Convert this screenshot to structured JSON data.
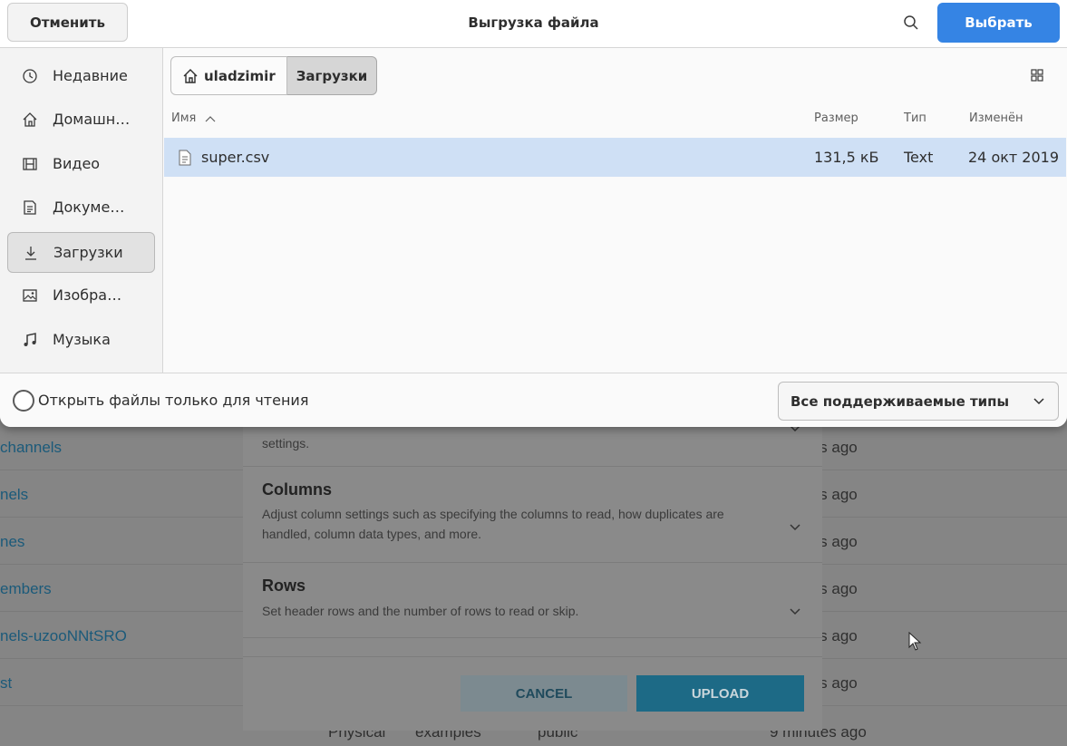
{
  "dialog": {
    "title": "Выгрузка файла",
    "cancel_label": "Отменить",
    "choose_label": "Выбрать"
  },
  "sidebar": {
    "items": [
      {
        "label": "Недавние",
        "icon": "clock-icon",
        "active": false
      },
      {
        "label": "Домашн…",
        "icon": "home-icon",
        "active": false
      },
      {
        "label": "Видео",
        "icon": "film-icon",
        "active": false
      },
      {
        "label": "Докуме…",
        "icon": "document-icon",
        "active": false
      },
      {
        "label": "Загрузки",
        "icon": "download-icon",
        "active": true
      },
      {
        "label": "Изобра…",
        "icon": "image-icon",
        "active": false
      },
      {
        "label": "Музыка",
        "icon": "music-icon",
        "active": false
      }
    ]
  },
  "pathbar": {
    "home": "uladzimir",
    "current": "Загрузки"
  },
  "columns": {
    "name": "Имя",
    "size": "Размер",
    "type": "Тип",
    "modified": "Изменён"
  },
  "files": [
    {
      "name": "super.csv",
      "size": "131,5 кБ",
      "type": "Text",
      "modified": "24 окт 2019",
      "selected": true
    }
  ],
  "footer": {
    "readonly_label": "Открыть файлы только для чтения",
    "filter_label": "Все поддерживаемые типы"
  },
  "background": {
    "rows": [
      {
        "name": "channels",
        "time": "tes ago"
      },
      {
        "name": "nels",
        "time": "tes ago"
      },
      {
        "name": "nes",
        "time": "tes ago"
      },
      {
        "name": "embers",
        "time": "tes ago"
      },
      {
        "name": "nels-uzooNNtSRO",
        "time": "tes ago"
      },
      {
        "name": "st",
        "time": "tes ago"
      }
    ],
    "last_row": {
      "col1": "Physical",
      "col2": "examples",
      "col3": "public",
      "time": "9 minutes ago"
    },
    "modal": {
      "partial_desc": "settings.",
      "columns_title": "Columns",
      "columns_desc": "Adjust column settings such as specifying the columns to read, how duplicates are handled, column data types, and more.",
      "rows_title": "Rows",
      "rows_desc": "Set header rows and the number of rows to read or skip.",
      "cancel_label": "CANCEL",
      "upload_label": "UPLOAD"
    }
  },
  "colors": {
    "accent": "#3584e4",
    "selection": "#cfe0f5"
  }
}
